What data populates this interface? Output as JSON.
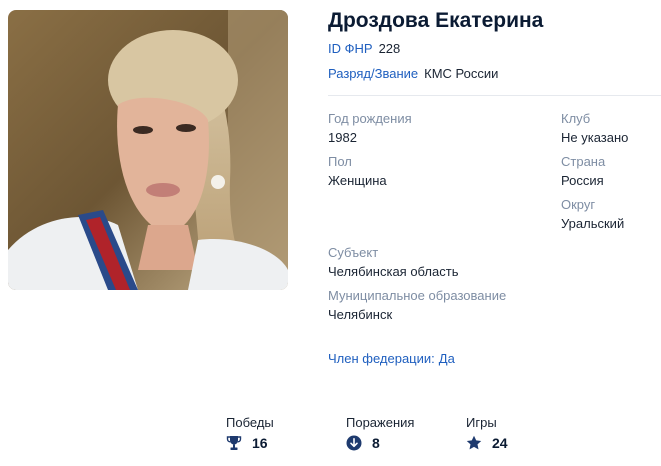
{
  "profile": {
    "name": "Дроздова Екатерина",
    "photo_alt": "Дроздова Екатерина",
    "id_label": "ID ФНР",
    "id_value": "228",
    "rank_label": "Разряд/Звание",
    "rank_value": "КМС России"
  },
  "details": {
    "birth_year_label": "Год рождения",
    "birth_year": "1982",
    "gender_label": "Пол",
    "gender": "Женщина",
    "club_label": "Клуб",
    "club": "Не указано",
    "country_label": "Страна",
    "country": "Россия",
    "district_label": "Округ",
    "district": "Уральский",
    "subject_label": "Субъект",
    "subject": "Челябинская область",
    "municipality_label": "Муниципальное образование",
    "municipality": "Челябинск",
    "member_label": "Член федерации:",
    "member_value": "Да"
  },
  "stats": {
    "wins_label": "Победы",
    "wins": "16",
    "wins_icon": "trophy-icon",
    "losses_label": "Поражения",
    "losses": "8",
    "losses_icon": "arrow-down-circle-icon",
    "games_label": "Игры",
    "games": "24",
    "games_icon": "star-icon"
  },
  "colors": {
    "accent": "#1f5fbf",
    "muted_label": "#7e8da3",
    "heading": "#0b1b33",
    "icon": "#1e3a6e"
  }
}
